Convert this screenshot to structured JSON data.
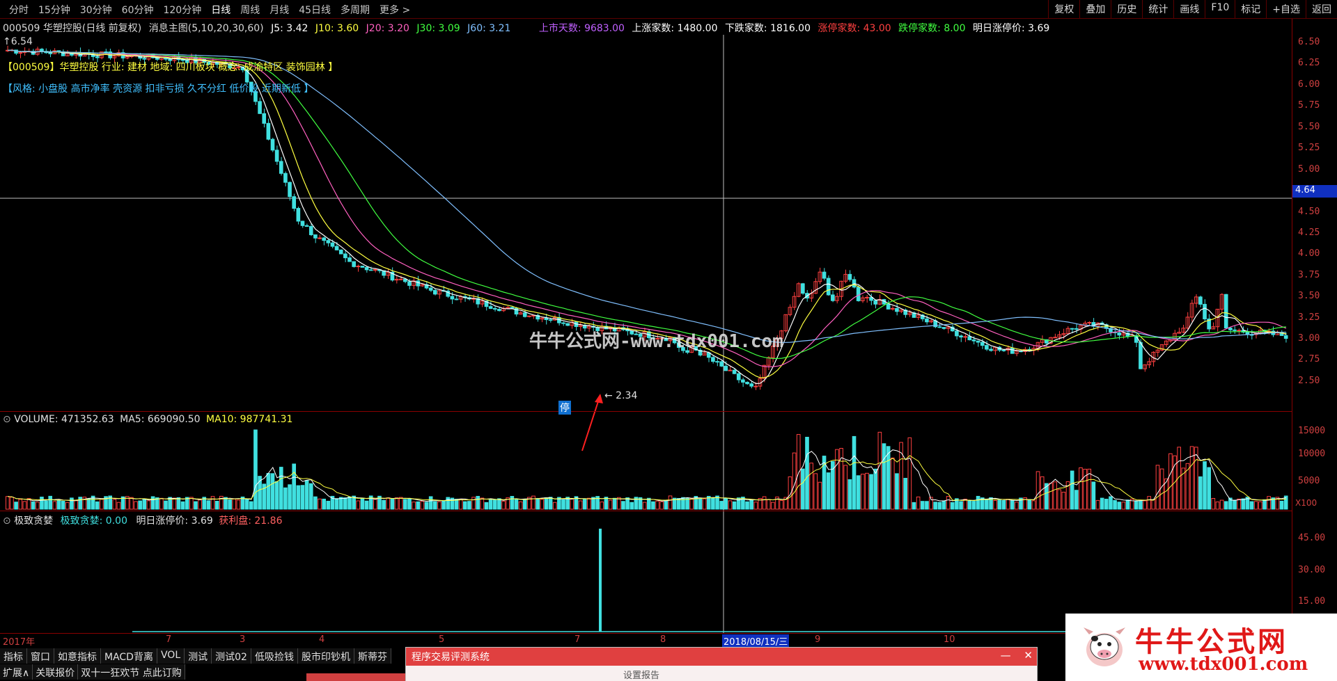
{
  "toolbar": {
    "periods": [
      "分时",
      "15分钟",
      "30分钟",
      "60分钟",
      "120分钟",
      "日线",
      "周线",
      "月线",
      "45日线",
      "多周期",
      "更多 >"
    ],
    "active_period": "日线",
    "right_buttons": [
      "复权",
      "叠加",
      "历史",
      "统计",
      "画线",
      "F10",
      "标记",
      "+自选",
      "返回"
    ]
  },
  "infoline": {
    "stock": "000509 华塑控股(日线 前复权)",
    "main_chart": "消息主图(5,10,20,30,60)",
    "j5": "J5: 3.42",
    "j10": "J10: 3.60",
    "j20": "J20: 3.20",
    "j30": "J30: 3.09",
    "j60": "J60: 3.21",
    "up_days": "上市天数: 9683.00",
    "up_count": "上涨家数: 1480.00",
    "down_count": "下跌家数: 1816.00",
    "limit_up": "涨停家数: 43.00",
    "limit_down": "跌停家数: 8.00",
    "next_limit": "明日涨停价: 3.69"
  },
  "overlays": {
    "high_price": "6.54",
    "industry": "【000509】华塑控股 行业: 建材 地域: 四川板块 概念: 成渝特区 装饰园林 】",
    "style": "【风格: 小盘股 高市净率 壳资源 扣非亏损 久不分红 低价股 近期新低 】",
    "low_marker": "← 2.34",
    "stop_badge": "停"
  },
  "volume": {
    "label": "VOLUME: 471352.63",
    "ma5": "MA5: 669090.50",
    "ma10": "MA10: 987741.31",
    "unit": "X100"
  },
  "indicator": {
    "name": "极致贪婪",
    "value": "极致贪婪: 0.00",
    "next_limit": "明日涨停价: 3.69",
    "profit": "获利盘: 21.86"
  },
  "axis": {
    "price_ticks": [
      "6.50",
      "6.25",
      "6.00",
      "5.75",
      "5.50",
      "5.25",
      "5.00",
      "4.50",
      "4.25",
      "4.00",
      "3.75",
      "3.50",
      "3.25",
      "3.00",
      "2.75",
      "2.50"
    ],
    "current_price": "4.64",
    "volume_ticks": [
      "15000",
      "10000",
      "5000"
    ],
    "indicator_ticks": [
      "45.00",
      "30.00",
      "15.00"
    ]
  },
  "dates": {
    "year": "2017年",
    "labels": [
      "7",
      "3",
      "4",
      "5",
      "7",
      "8",
      "9",
      "10"
    ],
    "cursor_date": "2018/08/15/三"
  },
  "tabs": [
    "指标",
    "窗口",
    "如意指标",
    "MACD背离",
    "VOL",
    "测试",
    "测试02",
    "低吸捡钱",
    "股市印钞机",
    "斯蒂芬"
  ],
  "tabs2": [
    "扩展∧",
    "关联报价",
    "双十一狂欢节 点此订购"
  ],
  "popup": {
    "title": "程序交易评测系统",
    "body": "设置报告",
    "minimize": "—",
    "close": "✕"
  },
  "watermark": {
    "cn": "牛牛公式网",
    "url": "www.tdx001.com"
  },
  "logo": {
    "title": "牛牛公式网",
    "url": "www.tdx001.com"
  },
  "colors": {
    "up": "#ff4040",
    "down": "#40e0e0",
    "ma5": "#ffffff",
    "ma10": "#ffff40",
    "ma20": "#ff60c0",
    "ma30": "#40ff40",
    "ma60": "#80c0ff"
  }
}
